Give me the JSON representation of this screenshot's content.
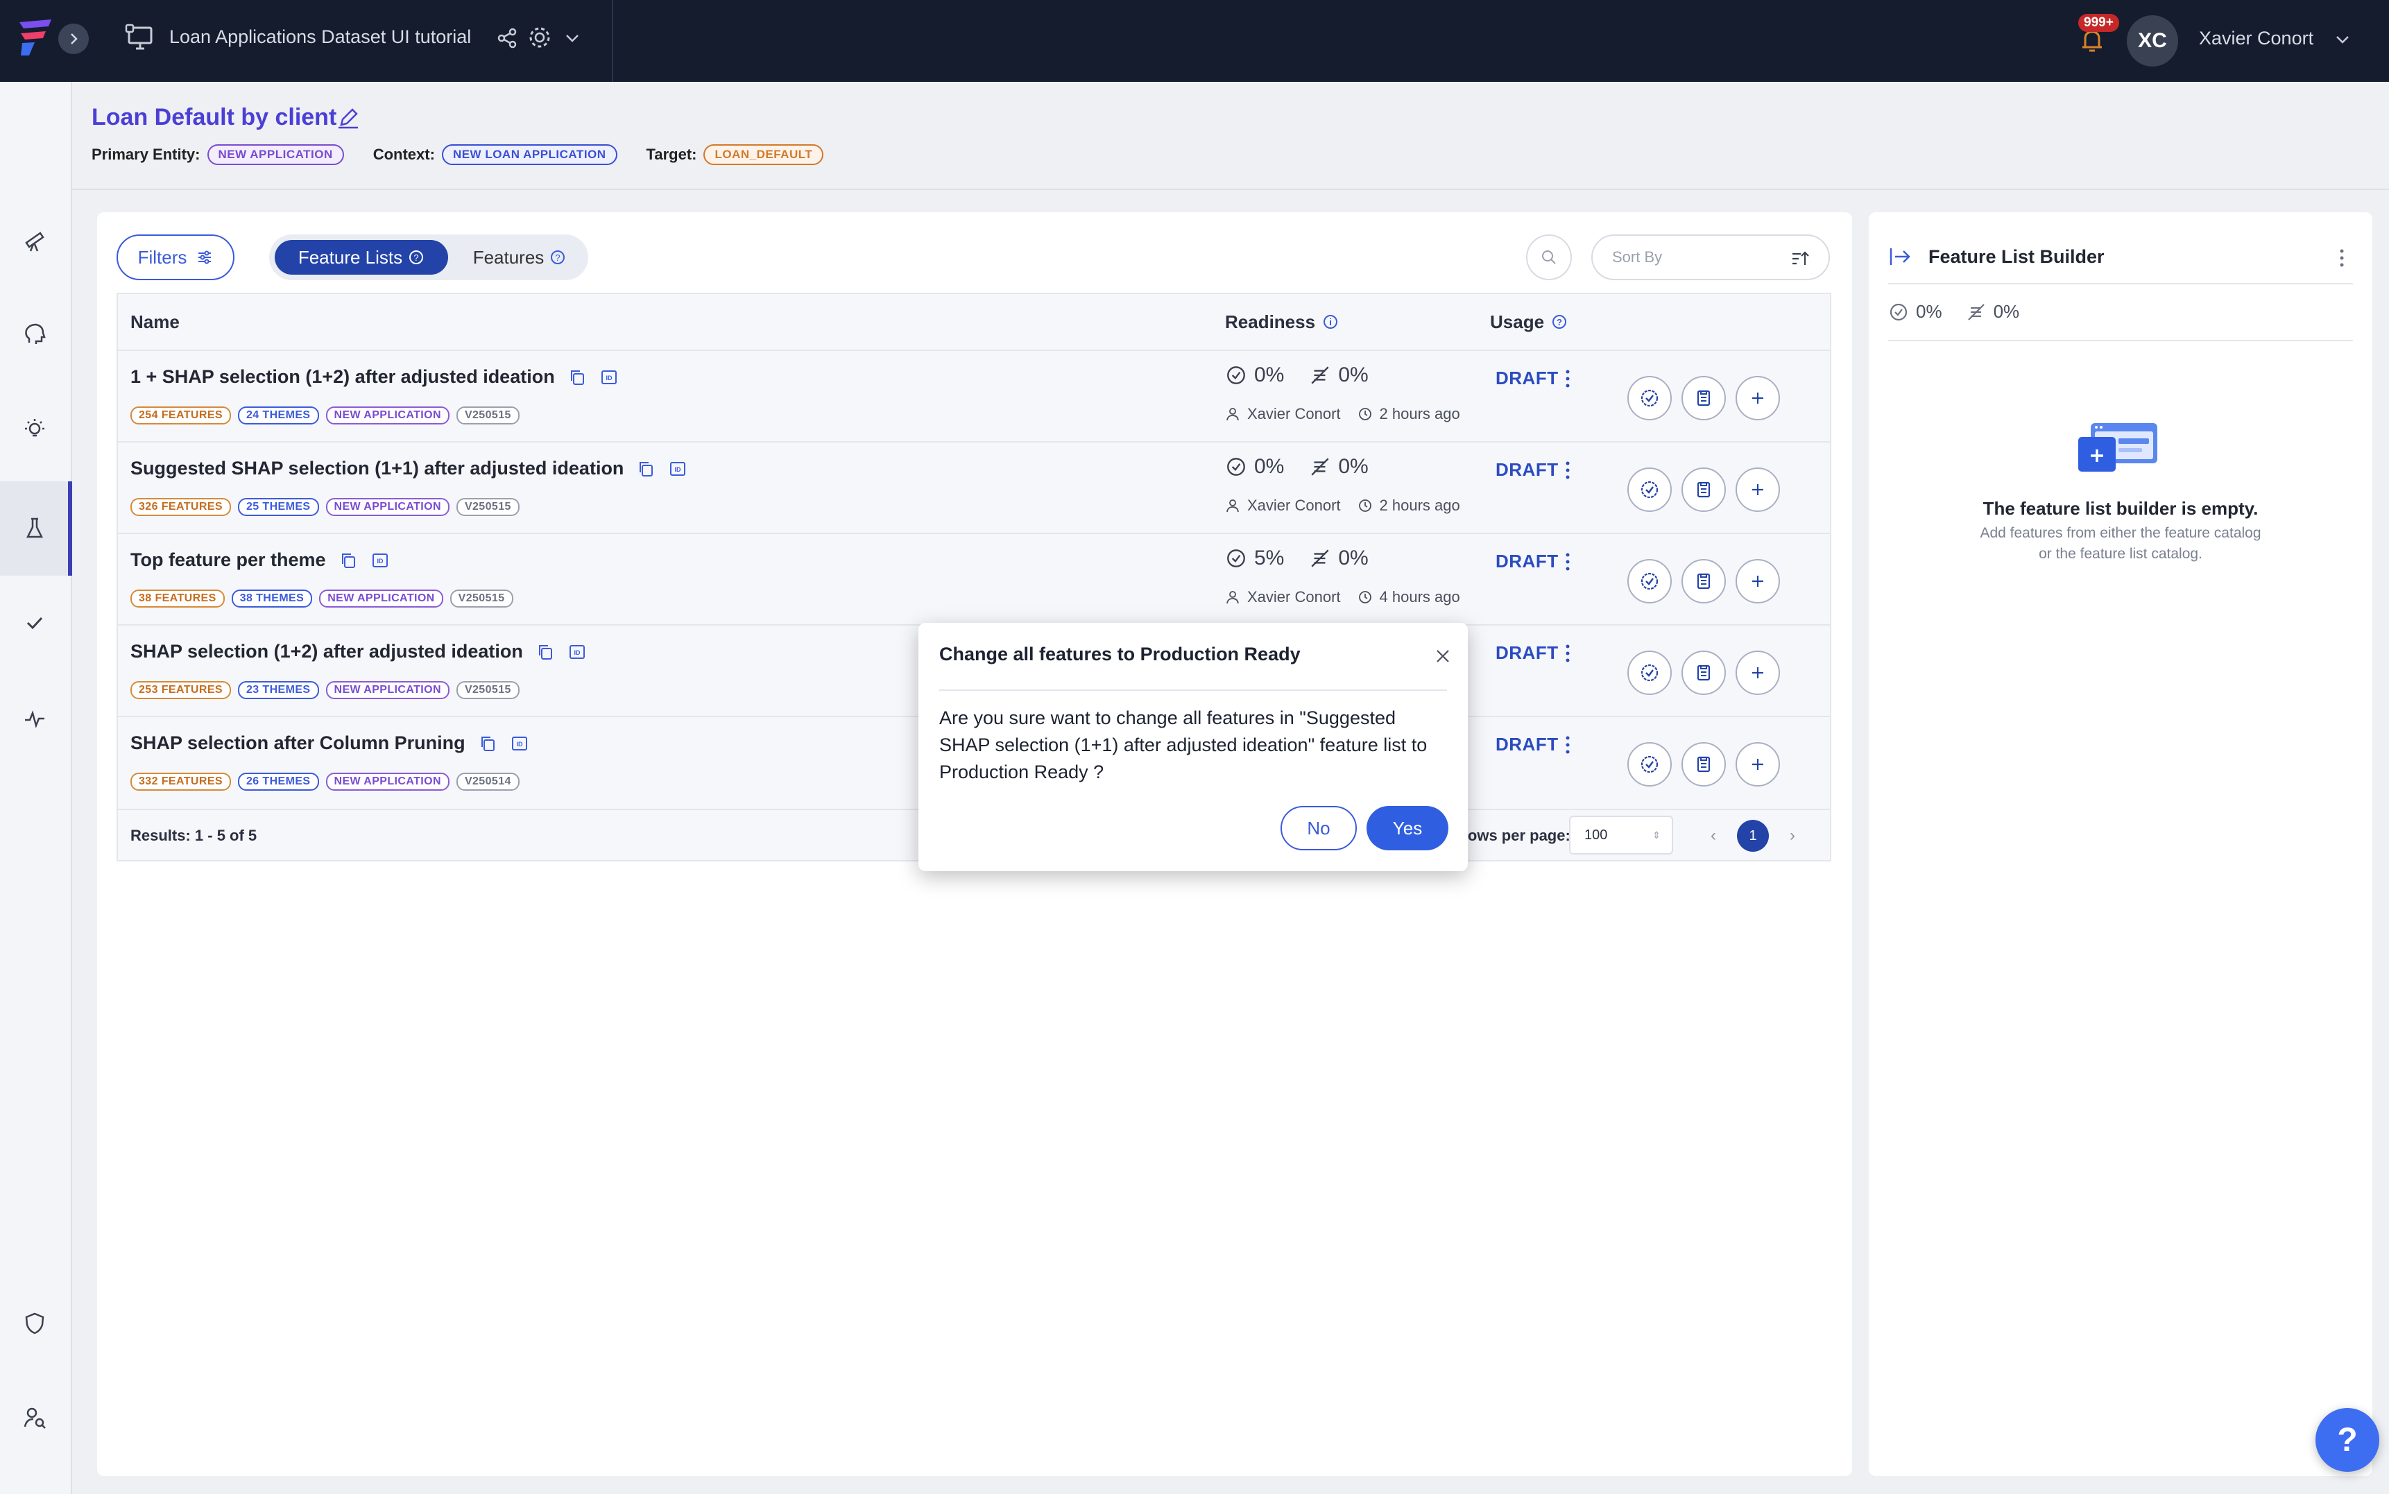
{
  "topbar": {
    "project_title": "Loan Applications Dataset UI tutorial",
    "notification_count": "999+",
    "avatar_initials": "XC",
    "user_name": "Xavier Conort"
  },
  "header": {
    "title": "Loan Default by client",
    "primary_entity_label": "Primary Entity:",
    "primary_entity_value": "NEW APPLICATION",
    "context_label": "Context:",
    "context_value": "NEW LOAN APPLICATION",
    "target_label": "Target:",
    "target_value": "LOAN_DEFAULT"
  },
  "toolbar": {
    "filters_label": "Filters",
    "tab_feature_lists": "Feature Lists",
    "tab_features": "Features",
    "sort_placeholder": "Sort By"
  },
  "table": {
    "headers": {
      "name": "Name",
      "readiness": "Readiness",
      "usage": "Usage"
    },
    "rows": [
      {
        "name": "1 + SHAP selection (1+2) after adjusted ideation",
        "tags": [
          "254 FEATURES",
          "24 THEMES",
          "NEW APPLICATION",
          "V250515"
        ],
        "ready_pct": "0%",
        "not_ready_pct": "0%",
        "owner": "Xavier Conort",
        "time": "2 hours ago",
        "usage": "DRAFT"
      },
      {
        "name": "Suggested SHAP selection (1+1) after adjusted ideation",
        "tags": [
          "326 FEATURES",
          "25 THEMES",
          "NEW APPLICATION",
          "V250515"
        ],
        "ready_pct": "0%",
        "not_ready_pct": "0%",
        "owner": "Xavier Conort",
        "time": "2 hours ago",
        "usage": "DRAFT"
      },
      {
        "name": "Top feature per theme",
        "tags": [
          "38 FEATURES",
          "38 THEMES",
          "NEW APPLICATION",
          "V250515"
        ],
        "ready_pct": "5%",
        "not_ready_pct": "0%",
        "owner": "Xavier Conort",
        "time": "4 hours ago",
        "usage": "DRAFT"
      },
      {
        "name": "SHAP selection (1+2) after adjusted ideation",
        "tags": [
          "253 FEATURES",
          "23 THEMES",
          "NEW APPLICATION",
          "V250515"
        ],
        "ready_pct": "",
        "not_ready_pct": "",
        "owner": "",
        "time": "",
        "usage": "DRAFT"
      },
      {
        "name": "SHAP selection after Column Pruning",
        "tags": [
          "332 FEATURES",
          "26 THEMES",
          "NEW APPLICATION",
          "V250514"
        ],
        "ready_pct": "",
        "not_ready_pct": "",
        "owner": "",
        "time": "",
        "usage": "DRAFT"
      }
    ],
    "results_text": "Results: 1 - 5 of 5",
    "rows_per_page_label": "Rows per page:",
    "rows_per_page_value": "100",
    "current_page": "1"
  },
  "feature_list_builder": {
    "title": "Feature List Builder",
    "ready_pct": "0%",
    "not_ready_pct": "0%",
    "empty_title": "The feature list builder is empty.",
    "empty_line1": "Add features from either the feature catalog",
    "empty_line2": "or the feature list catalog."
  },
  "modal": {
    "title": "Change all features to Production Ready",
    "body": "Are you sure want to change all features in \"Suggested SHAP selection (1+1) after adjusted ideation\" feature list to Production Ready ?",
    "no_label": "No",
    "yes_label": "Yes"
  },
  "help": {
    "label": "?"
  },
  "colors": {
    "accent": "#2343a8",
    "topbar_bg": "#151c2e",
    "title_purple": "#4b3fd6",
    "draft_blue": "#2b4cc0",
    "yes_button": "#2f5fe0"
  }
}
